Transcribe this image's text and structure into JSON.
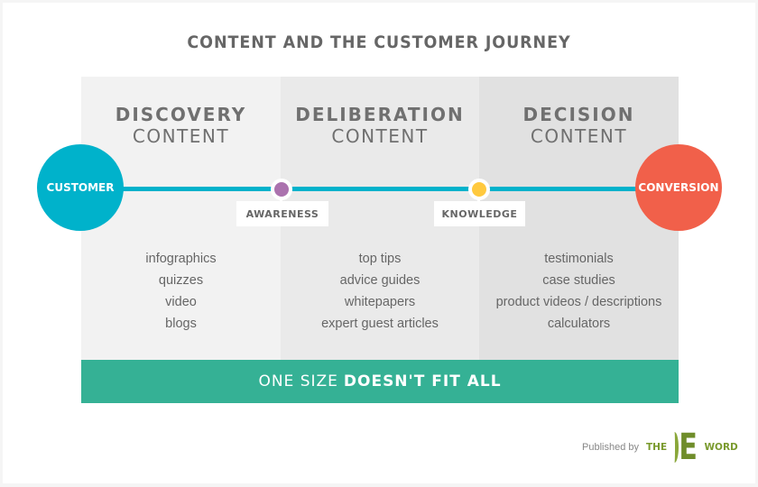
{
  "title": "CONTENT AND THE CUSTOMER JOURNEY",
  "stages": [
    {
      "name": "DISCOVERY",
      "subtitle": "CONTENT",
      "items": [
        "infographics",
        "quizzes",
        "video",
        "blogs"
      ]
    },
    {
      "name": "DELIBERATION",
      "subtitle": "CONTENT",
      "items": [
        "top tips",
        "advice guides",
        "whitepapers",
        "expert guest articles"
      ]
    },
    {
      "name": "DECISION",
      "subtitle": "CONTENT",
      "items": [
        "testimonials",
        "case studies",
        "product videos / descriptions",
        "calculators"
      ]
    }
  ],
  "journey": {
    "start": "CUSTOMER",
    "end": "CONVERSION",
    "milestones": [
      {
        "label": "AWARENESS",
        "color": "#ab72ae"
      },
      {
        "label": "KNOWLEDGE",
        "color": "#ffc93e"
      }
    ],
    "colors": {
      "line": "#00b2cb",
      "start": "#00b2cb",
      "end": "#f1604a"
    }
  },
  "banner": {
    "text_regular": "ONE SIZE",
    "text_bold": "DOESN'T FIT ALL",
    "color": "#35b195"
  },
  "footer": {
    "published_by": "Published by",
    "logo_left": "THE",
    "logo_mark": "E",
    "logo_right": "WORD"
  }
}
